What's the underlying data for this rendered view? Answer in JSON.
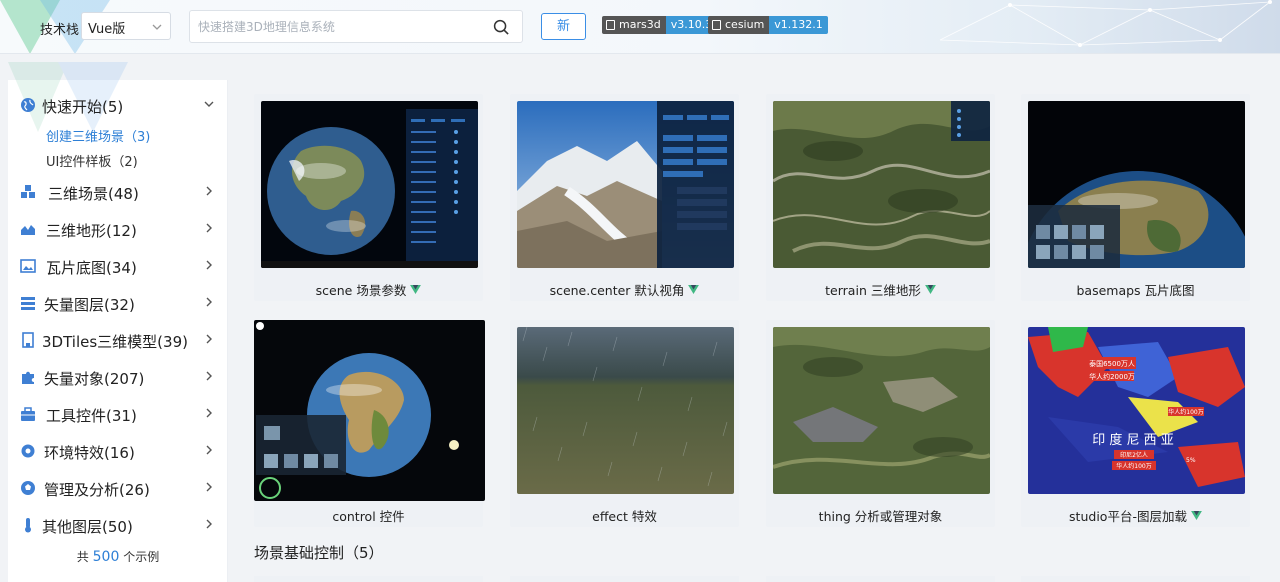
{
  "header": {
    "stack_label": "技术栈",
    "stack_value": "Vue版",
    "search_placeholder": "快速搭建3D地理信息系统",
    "new_button": "新",
    "badges": [
      {
        "key": "mars3d",
        "value": "v3.10.3"
      },
      {
        "key": "cesium",
        "value": "v1.132.1"
      }
    ]
  },
  "sidebar": {
    "groups": [
      {
        "label": "快速开始(5)",
        "icon": "globe-icon",
        "expanded": true
      },
      {
        "label": "三维场景(48)",
        "icon": "cubes-icon"
      },
      {
        "label": "三维地形(12)",
        "icon": "area-chart-icon"
      },
      {
        "label": "瓦片底图(34)",
        "icon": "image-icon"
      },
      {
        "label": "矢量图层(32)",
        "icon": "layers-list-icon"
      },
      {
        "label": "3DTiles三维模型(39)",
        "icon": "building-icon"
      },
      {
        "label": "矢量对象(207)",
        "icon": "puzzle-icon"
      },
      {
        "label": "工具控件(31)",
        "icon": "toolbox-icon"
      },
      {
        "label": "环境特效(16)",
        "icon": "gear-icon"
      },
      {
        "label": "管理及分析(26)",
        "icon": "football-icon"
      },
      {
        "label": "其他图层(50)",
        "icon": "thermometer-icon"
      }
    ],
    "sub_items": [
      {
        "label": "创建三维场景（3)",
        "active": true
      },
      {
        "label": "UI控件样板（2)",
        "active": false
      }
    ],
    "total_prefix": "共",
    "total_count": "500",
    "total_suffix": "个示例"
  },
  "cards": [
    {
      "title": "scene 场景参数",
      "vue": true
    },
    {
      "title": "scene.center 默认视角",
      "vue": true
    },
    {
      "title": "terrain 三维地形",
      "vue": true
    },
    {
      "title": "basemaps 瓦片底图",
      "vue": false
    },
    {
      "title": "control 控件",
      "vue": false
    },
    {
      "title": "effect 特效",
      "vue": false
    },
    {
      "title": "thing 分析或管理对象",
      "vue": false
    },
    {
      "title": "studio平台-图层加载",
      "vue": true
    }
  ],
  "map_labels": {
    "pop1": "泰国6500万人",
    "pop2": "华人约2000万",
    "pop3": "华人约100万",
    "indonesia": "印 度 尼 西 亚",
    "indo_pop": "印尼2亿人",
    "indo_cn": "华人约100万",
    "pct": "5%"
  },
  "section": {
    "title": "场景基础控制（5）"
  },
  "colors": {
    "accent": "#2d7fd6",
    "badge_key": "#555555",
    "badge_value": "#3b98d6",
    "vue_green": "#41b883"
  }
}
